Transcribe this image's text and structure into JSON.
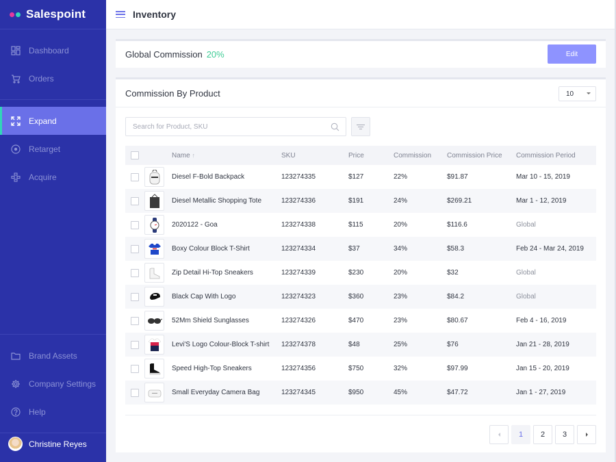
{
  "app": {
    "name": "Salespoint",
    "brand_colors": [
      "#e33a9e",
      "#31d6b8"
    ]
  },
  "sidebar": {
    "primary_items": [
      {
        "label": "Dashboard",
        "icon": "dashboard-icon",
        "active": false
      },
      {
        "label": "Orders",
        "icon": "cart-icon",
        "active": false
      }
    ],
    "secondary_items": [
      {
        "label": "Expand",
        "icon": "expand-icon",
        "active": true
      },
      {
        "label": "Retarget",
        "icon": "target-icon",
        "active": false
      },
      {
        "label": "Acquire",
        "icon": "network-icon",
        "active": false
      }
    ],
    "bottom_items": [
      {
        "label": "Brand Assets",
        "icon": "folder-icon"
      },
      {
        "label": "Company Settings",
        "icon": "gear-icon"
      },
      {
        "label": "Help",
        "icon": "help-icon"
      }
    ],
    "user": {
      "name": "Christine Reyes"
    }
  },
  "header": {
    "title": "Inventory"
  },
  "global_commission": {
    "label": "Global Commission",
    "value": "20%",
    "edit_label": "Edit"
  },
  "commission_table": {
    "title": "Commission By Product",
    "per_page": "10",
    "search_placeholder": "Search for Product, SKU",
    "columns": [
      "Name",
      "SKU",
      "Price",
      "Commission",
      "Commission Price",
      "Commission Period"
    ],
    "sort_indicator": "↑",
    "rows": [
      {
        "name": "Diesel F-Bold Backpack",
        "sku": "123274335",
        "price": "$127",
        "commission": "22%",
        "commission_price": "$91.87",
        "period": "Mar 10 - 15, 2019",
        "thumb": "backpack"
      },
      {
        "name": "Diesel Metallic Shopping Tote",
        "sku": "123274336",
        "price": "$191",
        "commission": "24%",
        "commission_price": "$269.21",
        "period": "Mar 1 - 12, 2019",
        "thumb": "tote"
      },
      {
        "name": "2020122 - Goa",
        "sku": "123274338",
        "price": "$115",
        "commission": "20%",
        "commission_price": "$116.6",
        "period": "Global",
        "thumb": "watch"
      },
      {
        "name": "Boxy Colour Block T-Shirt",
        "sku": "123274334",
        "price": "$37",
        "commission": "34%",
        "commission_price": "$58.3",
        "period": "Feb 24 - Mar 24, 2019",
        "thumb": "tshirt-blue"
      },
      {
        "name": "Zip Detail Hi-Top Sneakers",
        "sku": "123274339",
        "price": "$230",
        "commission": "20%",
        "commission_price": "$32",
        "period": "Global",
        "thumb": "sneaker-white"
      },
      {
        "name": "Black Cap With Logo",
        "sku": "123274323",
        "price": "$360",
        "commission": "23%",
        "commission_price": "$84.2",
        "period": "Global",
        "thumb": "cap"
      },
      {
        "name": "52Mm Shield Sunglasses",
        "sku": "123274326",
        "price": "$470",
        "commission": "23%",
        "commission_price": "$80.67",
        "period": "Feb 4 - 16, 2019",
        "thumb": "sunglasses"
      },
      {
        "name": "Levi'S Logo Colour-Block T-shirt",
        "sku": "123274378",
        "price": "$48",
        "commission": "25%",
        "commission_price": "$76",
        "period": "Jan 21 - 28, 2019",
        "thumb": "tshirt-red"
      },
      {
        "name": "Speed High-Top Sneakers",
        "sku": "123274356",
        "price": "$750",
        "commission": "32%",
        "commission_price": "$97.99",
        "period": "Jan 15 - 20, 2019",
        "thumb": "sneaker-black"
      },
      {
        "name": "Small Everyday Camera Bag",
        "sku": "123274345",
        "price": "$950",
        "commission": "45%",
        "commission_price": "$47.72",
        "period": "Jan 1 - 27, 2019",
        "thumb": "camera-bag"
      }
    ]
  },
  "pagination": {
    "pages": [
      "1",
      "2",
      "3"
    ],
    "current": "1"
  }
}
